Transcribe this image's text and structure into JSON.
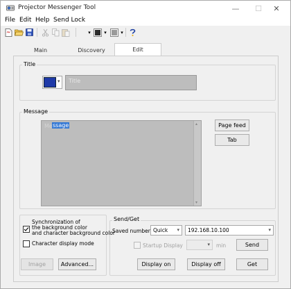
{
  "window": {
    "title": "Projector Messenger Tool",
    "controls": {
      "minimize": "—",
      "maximize": "☐",
      "close": "✕"
    }
  },
  "menu": {
    "file": "File",
    "edit": "Edit",
    "help": "Help",
    "send_lock": "Send Lock"
  },
  "tabs": {
    "main": "Main",
    "discovery": "Discovery",
    "edit": "Edit"
  },
  "title_section": {
    "label": "Title",
    "color": "#1f3aa8",
    "placeholder": "Title"
  },
  "message_section": {
    "label": "Message",
    "text_normal": "Me",
    "text_selected": "ssage",
    "page_feed": "Page feed",
    "tab": "Tab"
  },
  "options": {
    "sync_line1": "Synchronization of",
    "sync_line2": "the background color",
    "sync_line3": "and character background color",
    "sync_checked": true,
    "char_display_mode": "Character display mode",
    "image_button": "Image",
    "advanced_button": "Advanced..."
  },
  "send_get": {
    "label": "Send/Get",
    "saved_number_label": "Saved number",
    "saved_number_value": "Quick",
    "ip_address": "192.168.10.100",
    "startup_display": "Startup Display",
    "min_label": "min",
    "send_button": "Send",
    "display_on": "Display on",
    "display_off": "Display off",
    "get_button": "Get"
  },
  "colors": {
    "accent": "#1f3aa8",
    "selection": "#3478d4",
    "panel_gray": "#bdbdbd"
  }
}
